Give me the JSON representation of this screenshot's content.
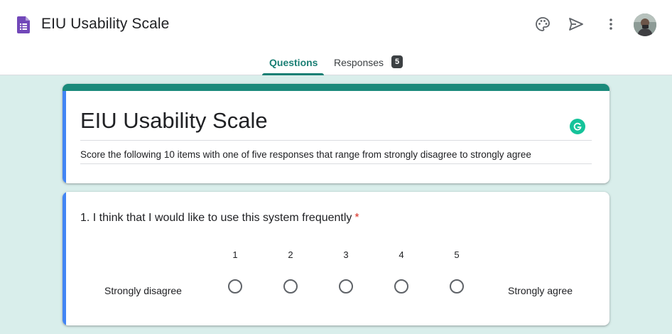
{
  "app": {
    "title": "EIU Usability Scale",
    "icon": "forms-doc-icon"
  },
  "header": {
    "actions": [
      "palette-icon",
      "send-icon",
      "more-vert-icon"
    ],
    "avatar": "user-avatar"
  },
  "tabs": [
    {
      "label": "Questions",
      "active": true
    },
    {
      "label": "Responses",
      "badge": "5"
    }
  ],
  "form": {
    "title": "EIU Usability Scale",
    "description": "Score the following 10 items with one of five responses that range from strongly disagree to strongly agree"
  },
  "questions": [
    {
      "text": "1. I think that I would like to use this system frequently",
      "required_mark": "*",
      "scale": [
        "1",
        "2",
        "3",
        "4",
        "5"
      ],
      "low_label": "Strongly disagree",
      "high_label": "Strongly agree"
    }
  ],
  "colors": {
    "accent": "#1a7f74",
    "header_band": "#1a8a7b",
    "active_band": "#4285f4",
    "background": "#d9eeeb",
    "required": "#d93025"
  }
}
